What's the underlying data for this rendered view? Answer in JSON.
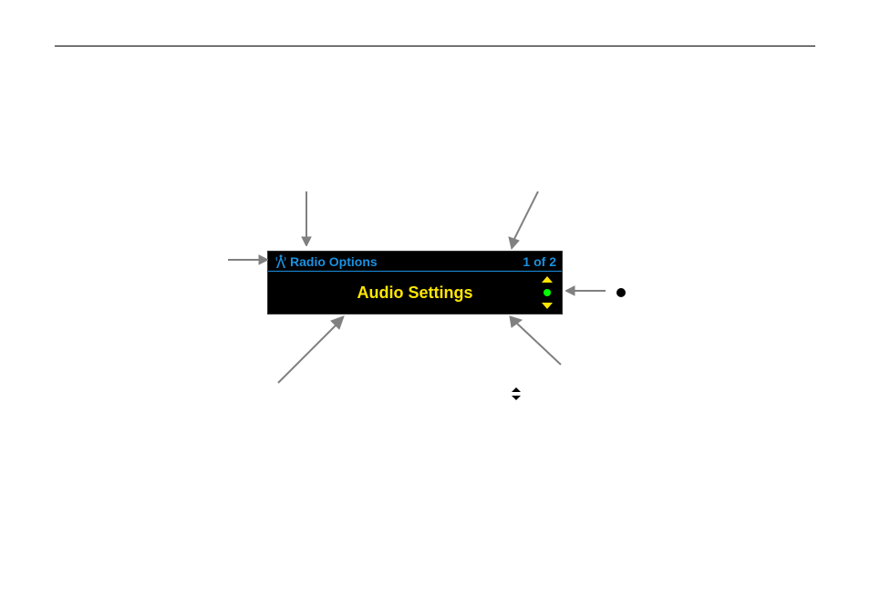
{
  "lcd": {
    "header_title": "Radio Options",
    "header_count": "1 of 2",
    "menu_item": "Audio Settings"
  }
}
